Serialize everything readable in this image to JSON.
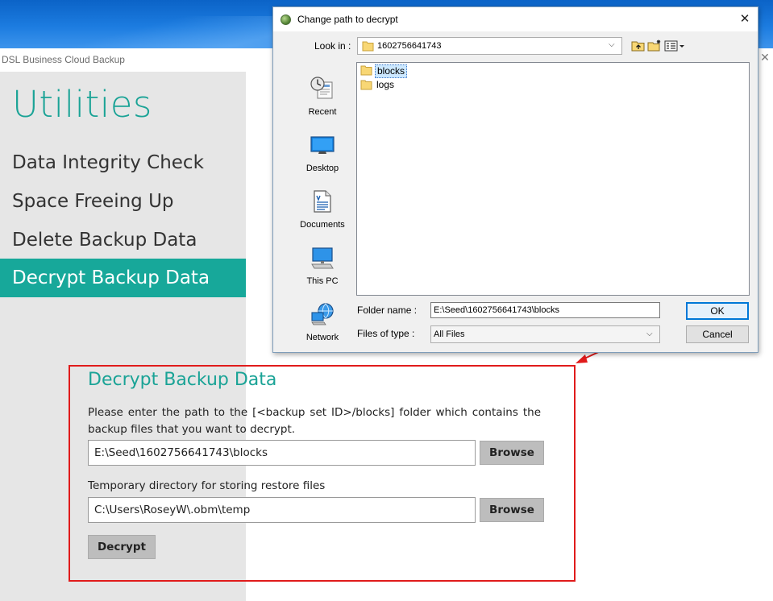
{
  "app": {
    "title": "DSL Business Cloud Backup",
    "close_glyph": "✕"
  },
  "sidebar": {
    "title": "Utilities",
    "items": [
      {
        "label": "Data Integrity Check",
        "active": false
      },
      {
        "label": "Space Freeing Up",
        "active": false
      },
      {
        "label": "Delete Backup Data",
        "active": false
      },
      {
        "label": "Decrypt Backup Data",
        "active": true
      }
    ]
  },
  "decrypt_panel": {
    "heading": "Decrypt Backup Data",
    "description": "Please enter the path to the [<backup set ID>/blocks] folder which contains the backup files that you want to decrypt.",
    "path_value": "E:\\Seed\\1602756641743\\blocks",
    "browse_label": "Browse",
    "temp_label": "Temporary directory for storing restore files",
    "temp_value": "C:\\Users\\RoseyW\\.obm\\temp",
    "decrypt_label": "Decrypt"
  },
  "dialog": {
    "title": "Change path to decrypt",
    "close_glyph": "✕",
    "look_in_label": "Look in :",
    "look_in_value": "1602756641743",
    "toolbar_icons": [
      "up-one-level-icon",
      "create-new-folder-icon",
      "view-menu-icon"
    ],
    "places": [
      {
        "label": "Recent",
        "icon": "recent-icon"
      },
      {
        "label": "Desktop",
        "icon": "desktop-icon"
      },
      {
        "label": "Documents",
        "icon": "documents-icon"
      },
      {
        "label": "This PC",
        "icon": "computer-icon"
      },
      {
        "label": "Network",
        "icon": "network-icon"
      }
    ],
    "files": [
      {
        "name": "blocks",
        "selected": true
      },
      {
        "name": "logs",
        "selected": false
      }
    ],
    "folder_name_label": "Folder name :",
    "folder_name_value": "E:\\Seed\\1602756641743\\blocks",
    "files_of_type_label": "Files of type :",
    "files_of_type_value": "All Files",
    "ok_label": "OK",
    "cancel_label": "Cancel"
  },
  "colors": {
    "accent": "#17a89a",
    "annotation": "#e01b1b",
    "dialog_bg": "#f0f0f0",
    "selection": "#cce8ff"
  }
}
